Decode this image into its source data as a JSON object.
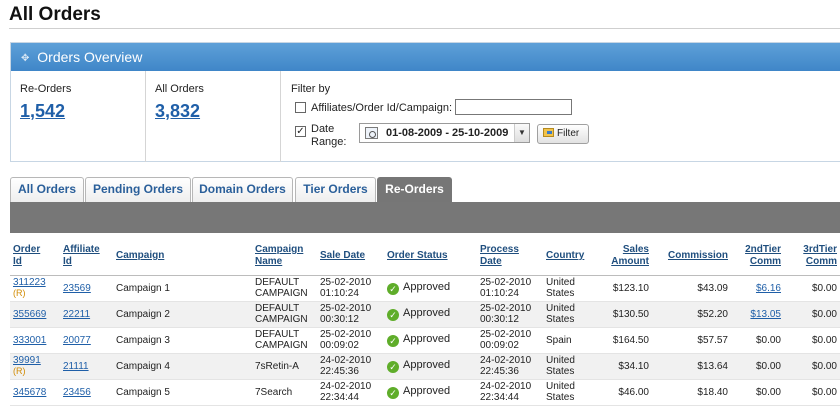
{
  "page": {
    "title": "All Orders"
  },
  "overview": {
    "header": "Orders Overview",
    "reorders": {
      "label": "Re-Orders",
      "value": "1,542"
    },
    "all_orders": {
      "label": "All Orders",
      "value": "3,832"
    },
    "filter": {
      "title": "Filter by",
      "affiliates_label": "Affiliates/Order Id/Campaign:",
      "affiliates_checked": false,
      "affiliates_value": "",
      "date_label_1": "Date",
      "date_label_2": "Range:",
      "date_checked": true,
      "date_value": "01-08-2009 - 25-10-2009",
      "button": "Filter"
    }
  },
  "tabs": [
    {
      "label": "All Orders",
      "active": false
    },
    {
      "label": "Pending Orders",
      "active": false
    },
    {
      "label": "Domain Orders",
      "active": false
    },
    {
      "label": "Tier Orders",
      "active": false
    },
    {
      "label": "Re-Orders",
      "active": true
    }
  ],
  "table": {
    "headers": {
      "order_id": [
        "Order",
        "Id"
      ],
      "affiliate_id": [
        "Affiliate",
        "Id"
      ],
      "campaign": "Campaign",
      "campaign_name": [
        "Campaign",
        "Name"
      ],
      "sale_date": "Sale Date",
      "order_status": "Order Status",
      "process_date": [
        "Process",
        "Date"
      ],
      "country": "Country",
      "sales_amount": [
        "Sales",
        "Amount"
      ],
      "commission": "Commission",
      "tier2": [
        "2ndTier",
        "Comm"
      ],
      "tier3": [
        "3rdTier",
        "Comm"
      ]
    },
    "rows": [
      {
        "order_id": "311223",
        "reorder_mark": "(R)",
        "affiliate_id": "23569",
        "campaign": "Campaign 1",
        "campaign_name": [
          "DEFAULT",
          "CAMPAIGN"
        ],
        "sale_date": [
          "25-02-2010",
          "01:10:24"
        ],
        "status": "Approved",
        "process_date": [
          "25-02-2010",
          "01:10:24"
        ],
        "country": [
          "United",
          "States"
        ],
        "sales_amount": "$123.10",
        "commission": "$43.09",
        "tier2": "$6.16",
        "tier2_link": true,
        "tier3": "$0.00"
      },
      {
        "order_id": "355669",
        "reorder_mark": "",
        "affiliate_id": "22211",
        "campaign": "Campaign 2",
        "campaign_name": [
          "DEFAULT",
          "CAMPAIGN"
        ],
        "sale_date": [
          "25-02-2010",
          "00:30:12"
        ],
        "status": "Approved",
        "process_date": [
          "25-02-2010",
          "00:30:12"
        ],
        "country": [
          "United",
          "States"
        ],
        "sales_amount": "$130.50",
        "commission": "$52.20",
        "tier2": "$13.05",
        "tier2_link": true,
        "tier3": "$0.00"
      },
      {
        "order_id": "333001",
        "reorder_mark": "",
        "affiliate_id": "20077",
        "campaign": "Campaign 3",
        "campaign_name": [
          "DEFAULT",
          "CAMPAIGN"
        ],
        "sale_date": [
          "25-02-2010",
          "00:09:02"
        ],
        "status": "Approved",
        "process_date": [
          "25-02-2010",
          "00:09:02"
        ],
        "country": [
          "Spain",
          ""
        ],
        "sales_amount": "$164.50",
        "commission": "$57.57",
        "tier2": "$0.00",
        "tier2_link": false,
        "tier3": "$0.00"
      },
      {
        "order_id": "39991",
        "reorder_mark": "(R)",
        "affiliate_id": "21111",
        "campaign": "Campaign 4",
        "campaign_name": [
          "7sRetin-A",
          ""
        ],
        "sale_date": [
          "24-02-2010",
          "22:45:36"
        ],
        "status": "Approved",
        "process_date": [
          "24-02-2010",
          "22:45:36"
        ],
        "country": [
          "United",
          "States"
        ],
        "sales_amount": "$34.10",
        "commission": "$13.64",
        "tier2": "$0.00",
        "tier2_link": false,
        "tier3": "$0.00"
      },
      {
        "order_id": "345678",
        "reorder_mark": "",
        "affiliate_id": "23456",
        "campaign": "Campaign 5",
        "campaign_name": [
          "7Search",
          ""
        ],
        "sale_date": [
          "24-02-2010",
          "22:34:44"
        ],
        "status": "Approved",
        "process_date": [
          "24-02-2010",
          "22:34:44"
        ],
        "country": [
          "United",
          "States"
        ],
        "sales_amount": "$46.00",
        "commission": "$18.40",
        "tier2": "$0.00",
        "tier2_link": false,
        "tier3": "$0.00"
      }
    ]
  }
}
